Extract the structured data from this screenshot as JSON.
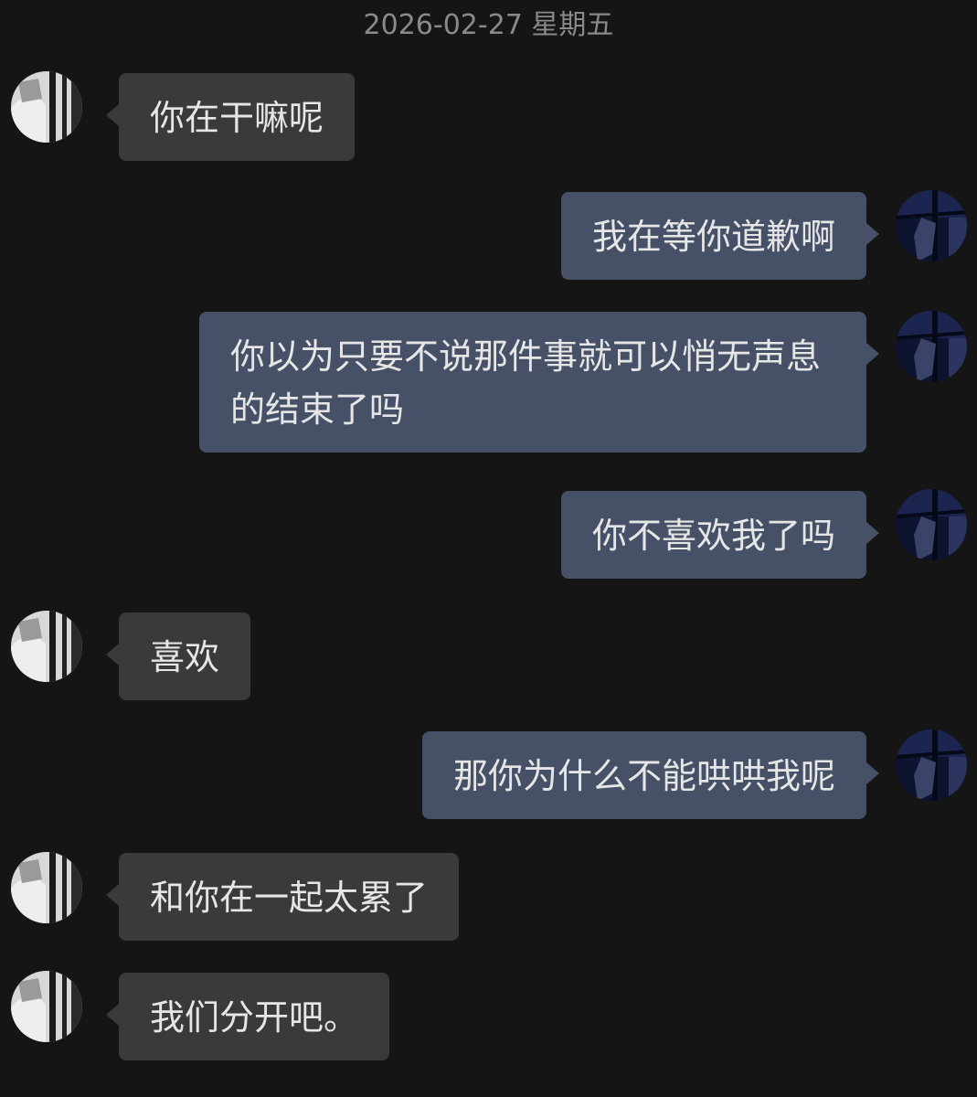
{
  "chat": {
    "date_header": "2026-02-27 星期五",
    "messages": [
      {
        "sender": "other",
        "text": "你在干嘛呢"
      },
      {
        "sender": "self",
        "text": "我在等你道歉啊"
      },
      {
        "sender": "self",
        "text": "你以为只要不说那件事就可以悄无声息的结束了吗"
      },
      {
        "sender": "self",
        "text": "你不喜欢我了吗"
      },
      {
        "sender": "other",
        "text": "喜欢"
      },
      {
        "sender": "self",
        "text": "那你为什么不能哄哄我呢"
      },
      {
        "sender": "other",
        "text": "和你在一起太累了"
      },
      {
        "sender": "other",
        "text": "我们分开吧。"
      }
    ]
  },
  "colors": {
    "background": "#151515",
    "incoming_bubble": "#3a3a3a",
    "outgoing_bubble": "#465066",
    "text": "#e6e6e6",
    "timestamp": "#8a8a8a"
  }
}
